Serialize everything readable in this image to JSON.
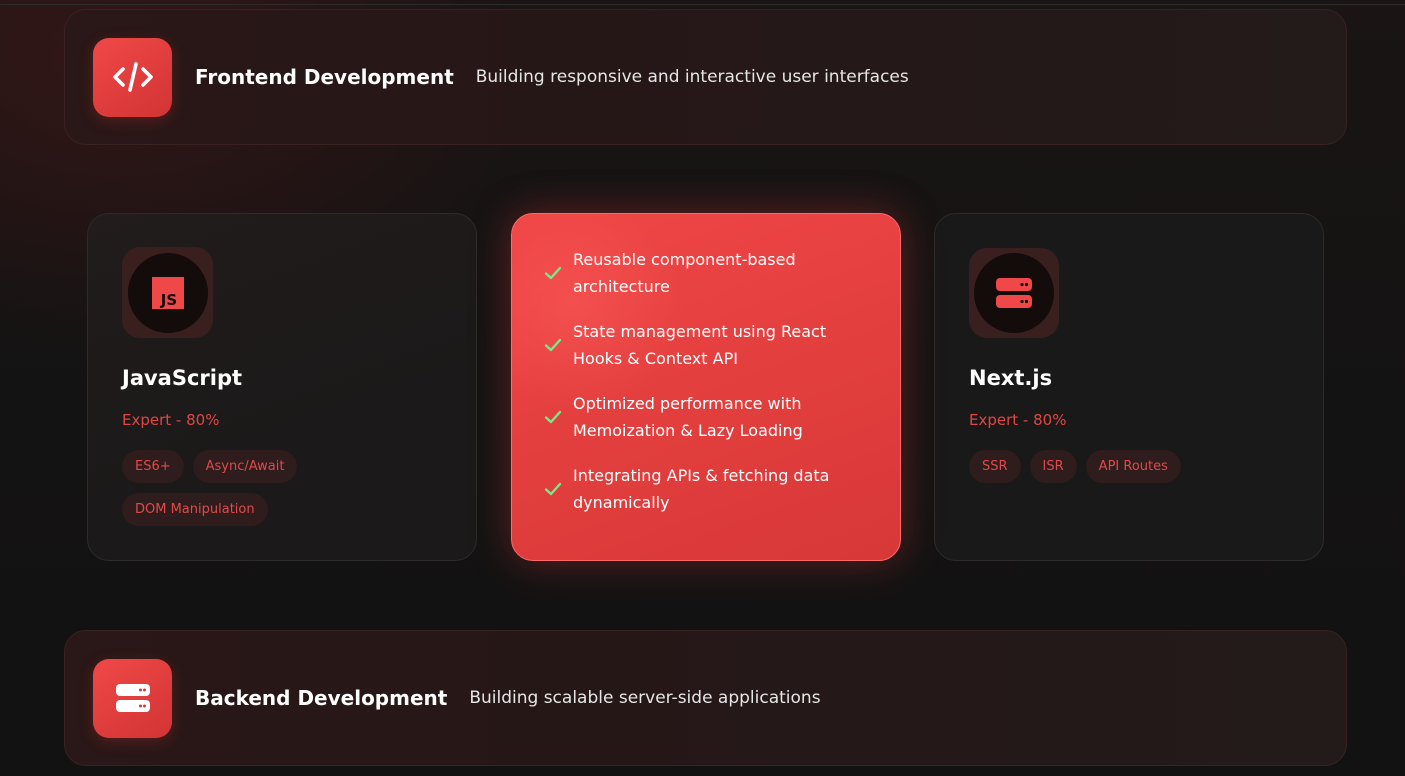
{
  "categories": {
    "frontend": {
      "title": "Frontend Development",
      "description": "Building responsive and interactive user interfaces",
      "icon": "code-icon"
    },
    "backend": {
      "title": "Backend Development",
      "description": "Building scalable server-side applications",
      "icon": "server-icon"
    }
  },
  "skills": {
    "javascript": {
      "name": "JavaScript",
      "level": "Expert - 80%",
      "icon": "javascript-icon",
      "tags": [
        "ES6+",
        "Async/Await",
        "DOM Manipulation"
      ],
      "icon_text": "JS"
    },
    "nextjs": {
      "name": "Next.js",
      "level": "Expert - 80%",
      "icon": "server-icon",
      "tags": [
        "SSR",
        "ISR",
        "API Routes"
      ]
    }
  },
  "features": {
    "items": [
      "Reusable component-based architecture",
      "State management using React Hooks & Context API",
      "Optimized performance with Memoization & Lazy Loading",
      "Integrating APIs & fetching data dynamically"
    ],
    "check_icon": "check-icon"
  },
  "colors": {
    "accent": "#e04646",
    "feature_card": "#e84242",
    "check": "#7ee787",
    "background": "#141414"
  }
}
